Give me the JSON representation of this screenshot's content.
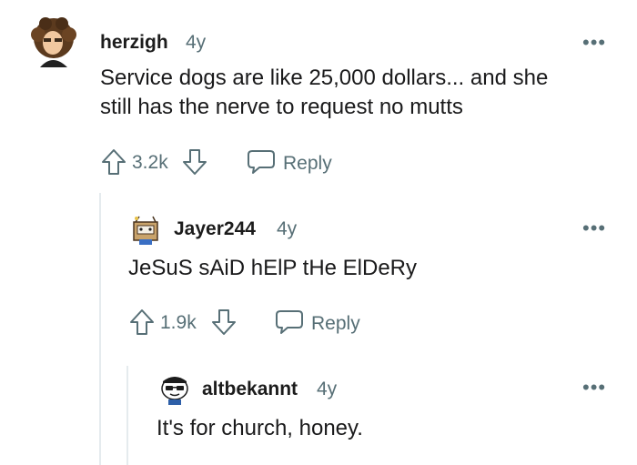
{
  "comments": [
    {
      "username": "herzigh",
      "age": "4y",
      "body": [
        "Service dogs are like 25,000 dollars... and she",
        "still has the nerve to request no mutts"
      ],
      "score": "3.2k",
      "reply_label": "Reply",
      "more_label": "•••"
    },
    {
      "username": "Jayer244",
      "age": "4y",
      "body": [
        "JeSuS sAiD hElP tHe ElDeRy"
      ],
      "score": "1.9k",
      "reply_label": "Reply",
      "more_label": "•••"
    },
    {
      "username": "altbekannt",
      "age": "4y",
      "body": [
        "It's for church, honey."
      ],
      "more_label": "•••"
    }
  ],
  "icons": {
    "upvote": "arrow-up-icon",
    "downvote": "arrow-down-icon",
    "reply": "speech-bubble-icon",
    "more": "more-dots-icon"
  },
  "colors": {
    "text": "#1c1c1c",
    "muted": "#576f76",
    "thread_line": "#e5ebee"
  }
}
